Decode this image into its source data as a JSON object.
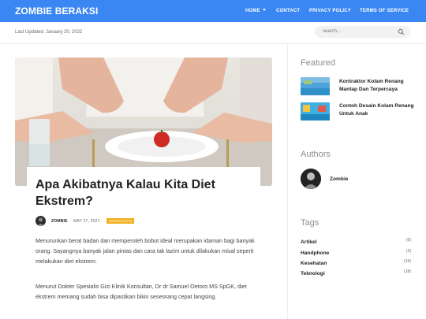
{
  "site": {
    "brand": "ZOMBIE BERAKSI",
    "nav": [
      "HOME",
      "CONTACT",
      "PRIVACY POLICY",
      "TERMS OF SERVICE"
    ]
  },
  "subbar": {
    "updated": "Last Updated: January 20, 2022",
    "search_placeholder": "search..."
  },
  "post": {
    "title": "Apa Akibatnya Kalau Kita Diet Ekstrem?",
    "author": "ZOMBIE",
    "date": "MAY 27, 2021",
    "category": "KESEHATAN",
    "paragraphs": [
      "Menurunkan berat badan dan memperoleh bobot ideal merupakan idaman bagi banyak orang. Sayangnya banyak jalan pintas dan cara tak lazim untuk dilakukan misal seperti melakukan diet ekstrem.",
      "Menurut Dokter Spesialis Gizi Klinik Konsultan, Dr dr Samuel Oetoro MS SpGK, diet ekstrem memang sudah bisa dipastikan bikin seseorang cepat langsing."
    ]
  },
  "sidebar": {
    "featured_heading": "Featured",
    "featured": [
      {
        "title": "Kontraktor Kolam Renang Mantap Dan Terpercaya"
      },
      {
        "title": "Contoh Desain Kolam Renang Untuk Anak"
      }
    ],
    "authors_heading": "Authors",
    "author": {
      "name": "Zombie"
    },
    "tags_heading": "Tags",
    "tags": [
      {
        "name": "Artikel",
        "count": "(5)"
      },
      {
        "name": "Handphone",
        "count": "(2)"
      },
      {
        "name": "Kesehatan",
        "count": "(19)"
      },
      {
        "name": "Teknologi",
        "count": "(18)"
      }
    ]
  },
  "colors": {
    "primary": "#3a86f2",
    "category_badge": "#f2b01e",
    "sidebar_heading": "#8a8d93"
  }
}
